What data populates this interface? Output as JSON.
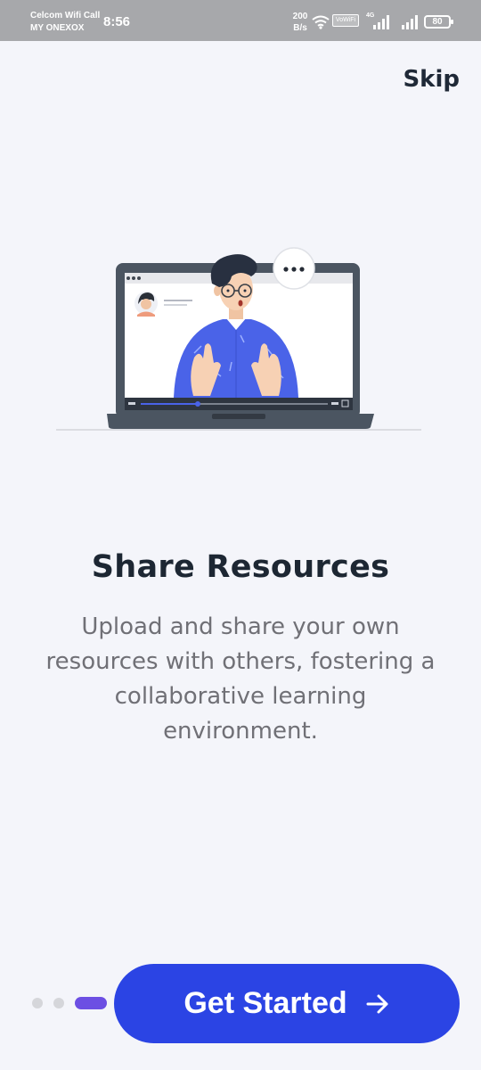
{
  "status_bar": {
    "carrier_primary": "Celcom Wifi Call",
    "carrier_secondary": "MY ONEXOX",
    "time": "8:56",
    "net_speed_value": "200",
    "net_speed_unit": "B/s",
    "vowifi_label": "VoWiFi",
    "network_type": "4G",
    "battery_level": "80",
    "icons": [
      "wifi-icon",
      "vowifi-icon",
      "signal-icon",
      "signal-icon",
      "battery-icon"
    ]
  },
  "onboarding": {
    "skip_label": "Skip",
    "illustration_icon": "video-call-illustration",
    "title": "Share Resources",
    "description": "Upload and share your own resources with others, fostering a collaborative learning environment.",
    "pager": {
      "total": 3,
      "active_index": 2
    },
    "cta_label": "Get Started",
    "cta_icon": "arrow-right-icon"
  },
  "colors": {
    "accent": "#2b44e4",
    "pager_active": "#6c4fe3",
    "pager_inactive": "#d5d6da",
    "background": "#f4f5fa",
    "shirt": "#4a63e8"
  }
}
